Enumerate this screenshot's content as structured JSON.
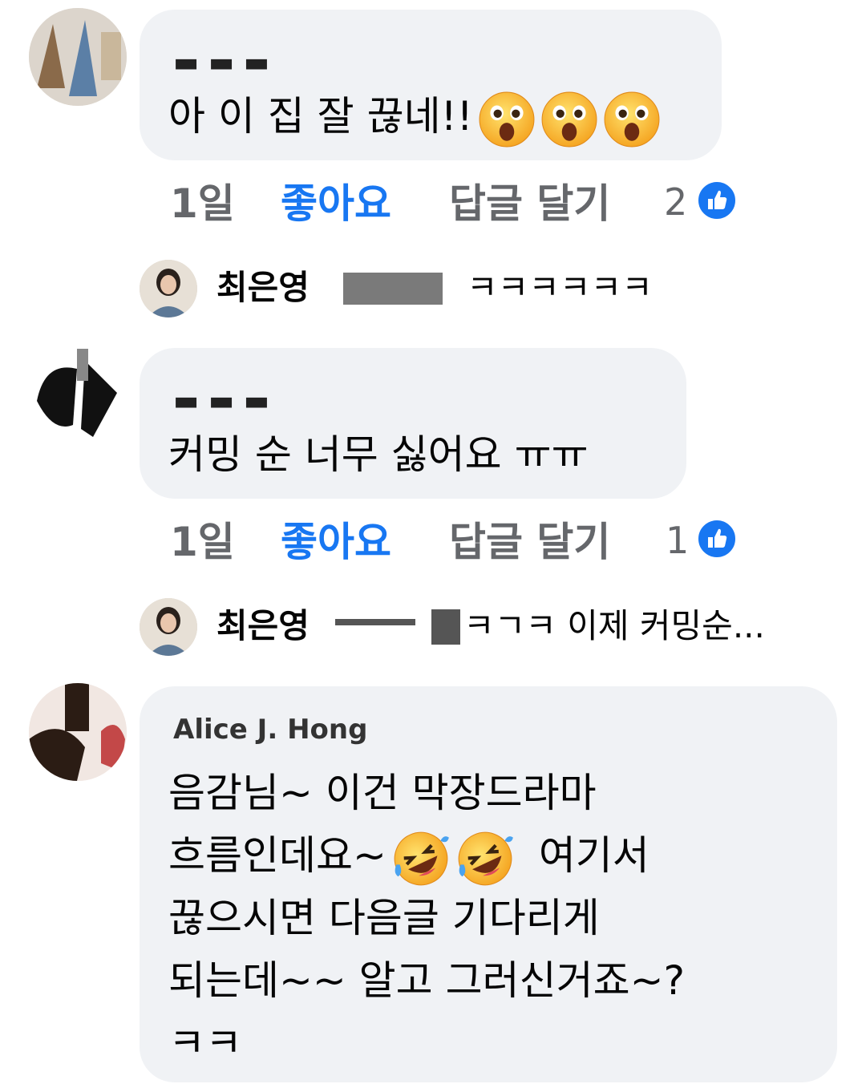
{
  "comments": [
    {
      "author": "▬ ▬ ▬",
      "lines": [
        "아 이 집 잘 끊네!!"
      ],
      "time": "1일",
      "like_label": "좋아요",
      "reply_label": "답글 달기",
      "like_count": "2",
      "reply": {
        "name": "최은영",
        "text": "ㅋㅋㅋㅋㅋㅋ"
      }
    },
    {
      "author": "▬ ▬ ▬",
      "lines": [
        "커밍 순 너무 싫어요 ㅠㅠ"
      ],
      "time": "1일",
      "like_label": "좋아요",
      "reply_label": "답글 달기",
      "like_count": "1",
      "reply": {
        "name": "최은영",
        "text": "ㅋㄱㅋ 이제 커밍순..."
      }
    },
    {
      "author": "Alice J. Hong",
      "lines": [
        "음감님~ 이건 막장드라마",
        "흐름인데요~",
        "여기서",
        "끊으시면 다음글 기다리게",
        "되는데~~ 알고 그러신거죠~?",
        "ㅋㅋ"
      ]
    }
  ],
  "icons": {
    "shocked_emoji": "astonished-face-emoji",
    "laughing_emoji": "rolling-on-floor-laughing-emoji",
    "like_badge": "thumbs-up-icon"
  },
  "colors": {
    "bubble": "#f0f2f5",
    "link_blue": "#1877f2",
    "meta_gray": "#65676b"
  }
}
